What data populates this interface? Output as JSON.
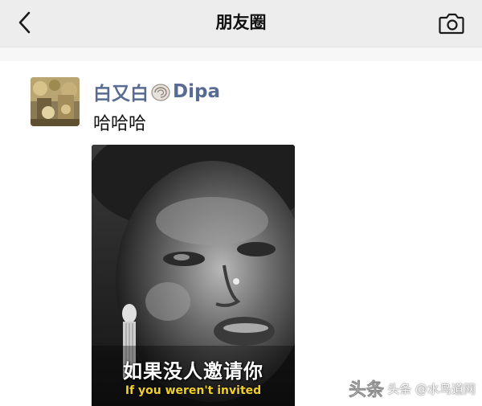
{
  "navbar": {
    "title": "朋友圈",
    "back_icon": "chevron-left-icon",
    "camera_icon": "camera-icon"
  },
  "post": {
    "author_name_prefix": "白又白",
    "author_name_suffix": "Dipa",
    "author_emoji_icon": "shell-icon",
    "text": "哈哈哈",
    "video": {
      "subtitle_cn": "如果没人邀请你",
      "subtitle_en": "If you weren't invited"
    }
  },
  "watermark": {
    "text": "头条 @水鸟道网"
  },
  "colors": {
    "navbar_bg": "#ededed",
    "author_name": "#576b95",
    "subtitle_en": "#f2d02a"
  }
}
